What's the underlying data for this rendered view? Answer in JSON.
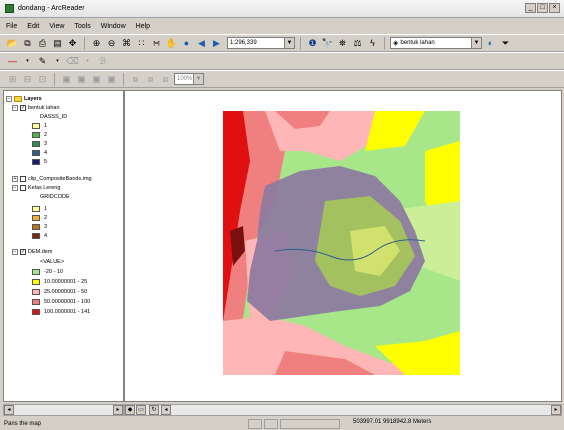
{
  "window": {
    "title": "dondang - ArcReader"
  },
  "menu": [
    "File",
    "Edit",
    "View",
    "Tools",
    "Window",
    "Help"
  ],
  "toolbar": {
    "scale": "1:296,339",
    "layer_select": "bentuk lahan"
  },
  "toolbar3": {
    "zoom": "100%"
  },
  "toc": {
    "root": "Layers",
    "layer1": {
      "name": "bentuk lahan",
      "field": "DASSS_ID",
      "classes": [
        {
          "label": "1",
          "color": "#ffff99"
        },
        {
          "label": "2",
          "color": "#55b24a"
        },
        {
          "label": "3",
          "color": "#2e8b57"
        },
        {
          "label": "4",
          "color": "#2f5d8c"
        },
        {
          "label": "5",
          "color": "#1a1a6e"
        }
      ]
    },
    "layer2": {
      "name": "clip_CompositeBands.img"
    },
    "layer3": {
      "name": "Kelas Lereng",
      "field": "GRIDCODE",
      "classes": [
        {
          "label": "1",
          "color": "#ffff99"
        },
        {
          "label": "2",
          "color": "#f0b040"
        },
        {
          "label": "3",
          "color": "#b8741a"
        },
        {
          "label": "4",
          "color": "#7a2a0a"
        }
      ]
    },
    "layer4": {
      "name": "DEM.dem",
      "field": "<VALUE>",
      "classes": [
        {
          "label": "-20 - 10",
          "color": "#a8e68a"
        },
        {
          "label": "10.00000001 - 25",
          "color": "#ffff00"
        },
        {
          "label": "25.00000001 - 50",
          "color": "#ffb6b6"
        },
        {
          "label": "50.00000001 - 100",
          "color": "#f08080"
        },
        {
          "label": "100.0000001 - 141",
          "color": "#e01010"
        }
      ]
    }
  },
  "status": {
    "message": "Pans the map",
    "coords": "503997.01  9918942.8 Meters"
  }
}
